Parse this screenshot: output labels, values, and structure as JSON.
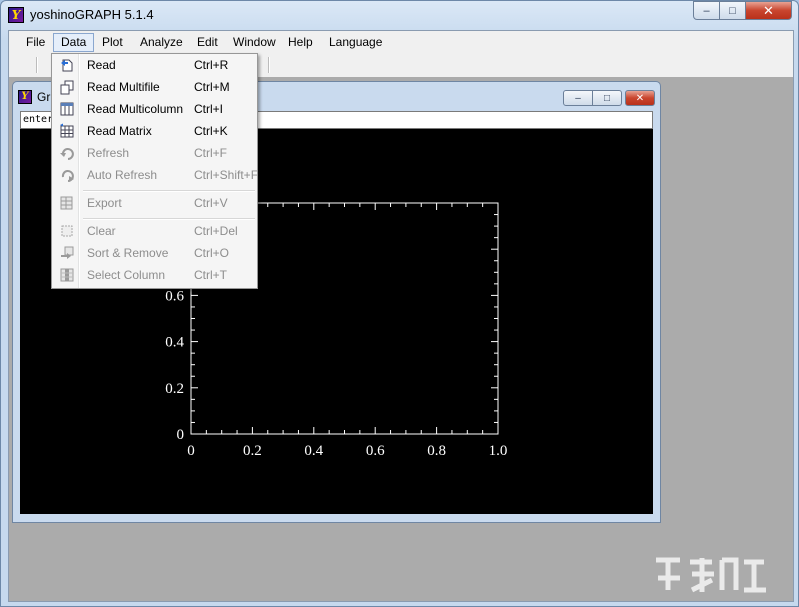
{
  "app": {
    "title": "yoshinoGRAPH 5.1.4",
    "logo_letter": "Y",
    "window_buttons": {
      "minimize": "–",
      "maximize": "□",
      "close": "✕"
    }
  },
  "menubar": {
    "items": [
      {
        "label": "File",
        "name": "file"
      },
      {
        "label": "Data",
        "name": "data",
        "active": true
      },
      {
        "label": "Plot",
        "name": "plot"
      },
      {
        "label": "Analyze",
        "name": "analyze"
      },
      {
        "label": "Edit",
        "name": "edit"
      },
      {
        "label": "Window",
        "name": "window"
      },
      {
        "label": "Help",
        "name": "help"
      },
      {
        "label": "Language",
        "name": "language"
      }
    ]
  },
  "data_menu": {
    "items": [
      {
        "label": "Read",
        "shortcut": "Ctrl+R",
        "enabled": true,
        "icon": "read-icon"
      },
      {
        "label": "Read Multifile",
        "shortcut": "Ctrl+M",
        "enabled": true,
        "icon": "read-multifile-icon"
      },
      {
        "label": "Read Multicolumn",
        "shortcut": "Ctrl+I",
        "enabled": true,
        "icon": "read-multicolumn-icon"
      },
      {
        "label": "Read Matrix",
        "shortcut": "Ctrl+K",
        "enabled": true,
        "icon": "read-matrix-icon"
      },
      {
        "label": "Refresh",
        "shortcut": "Ctrl+F",
        "enabled": false,
        "icon": "refresh-icon"
      },
      {
        "label": "Auto Refresh",
        "shortcut": "Ctrl+Shift+F",
        "enabled": false,
        "icon": "auto-refresh-icon"
      },
      {
        "separator": true
      },
      {
        "label": "Export",
        "shortcut": "Ctrl+V",
        "enabled": false,
        "icon": "export-icon"
      },
      {
        "separator": true
      },
      {
        "label": "Clear",
        "shortcut": "Ctrl+Del",
        "enabled": false,
        "icon": "clear-icon"
      },
      {
        "label": "Sort & Remove",
        "shortcut": "Ctrl+O",
        "enabled": false,
        "icon": "sort-remove-icon"
      },
      {
        "label": "Select Column",
        "shortcut": "Ctrl+T",
        "enabled": false,
        "icon": "select-column-icon"
      }
    ]
  },
  "graph_window": {
    "title": "Gr",
    "command_input": "enter",
    "window_buttons": {
      "minimize": "–",
      "maximize": "□",
      "close": "✕"
    }
  },
  "chart_data": {
    "type": "scatter",
    "title": "",
    "xlabel": "",
    "ylabel": "",
    "xlim": [
      0,
      1.0
    ],
    "ylim": [
      0,
      1.0
    ],
    "x_ticks": [
      "0",
      "0.2",
      "0.4",
      "0.6",
      "0.8",
      "1.0"
    ],
    "y_ticks": [
      "0",
      "0.2",
      "0.4",
      "0.6"
    ],
    "series": [],
    "background": "#000000",
    "foreground": "#ffffff"
  },
  "colors": {
    "menu_active_bg": "#e5eefa",
    "disabled_text": "#8d8d8d",
    "close_button": "#c9452e"
  }
}
